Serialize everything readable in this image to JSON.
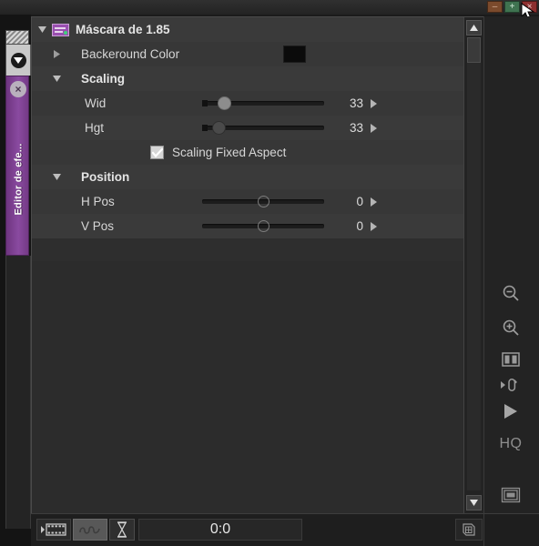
{
  "window": {
    "buttons": [
      {
        "name": "minimize-button",
        "glyph": "–"
      },
      {
        "name": "maximize-button",
        "glyph": "+"
      },
      {
        "name": "close-button",
        "glyph": "×"
      }
    ]
  },
  "left_dock": {
    "tab_label": "Editor de efe...",
    "close_glyph": "×",
    "tab_color": "#8a4aa0"
  },
  "properties": {
    "title": "Máscara de 1.85",
    "rows": [
      {
        "label": "Backeround Color",
        "type": "color",
        "value_swatch": "#0b0b0b"
      },
      {
        "label": "Scaling",
        "type": "group"
      },
      {
        "label": "Wid",
        "type": "slider",
        "value": "33"
      },
      {
        "label": "Hgt",
        "type": "slider",
        "value": "33"
      },
      {
        "label": "Scaling Fixed Aspect",
        "type": "checkbox",
        "checked": true
      },
      {
        "label": "Position",
        "type": "group"
      },
      {
        "label": "H Pos",
        "type": "slider",
        "value": "0"
      },
      {
        "label": "V Pos",
        "type": "slider",
        "value": "0"
      }
    ]
  },
  "tools": [
    {
      "name": "zoom-out-icon",
      "label": ""
    },
    {
      "name": "zoom-in-icon",
      "label": ""
    },
    {
      "name": "split-view-icon",
      "label": ""
    },
    {
      "name": "loop-playback-icon",
      "label": ""
    },
    {
      "name": "play-icon",
      "label": ""
    },
    {
      "name": "hq-button",
      "label": "HQ"
    },
    {
      "name": "monitor-icon",
      "label": ""
    }
  ],
  "bottom_bar": {
    "timecode": "0:0",
    "buttons": [
      {
        "name": "filmstrip-icon"
      },
      {
        "name": "waveform-icon"
      },
      {
        "name": "timer-icon"
      },
      {
        "name": "render-icon"
      }
    ]
  }
}
